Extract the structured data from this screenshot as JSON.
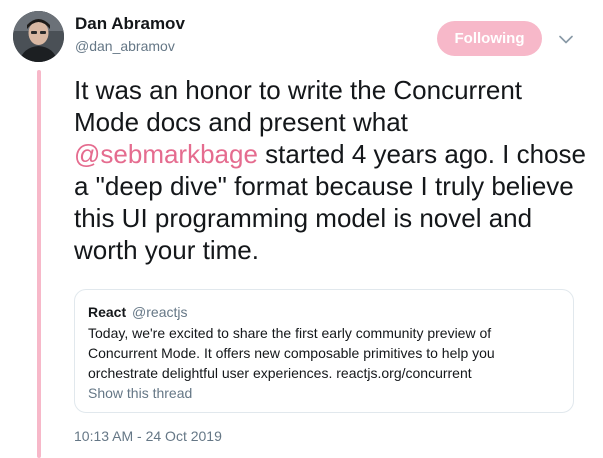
{
  "author": {
    "name": "Dan Abramov",
    "handle": "@dan_abramov"
  },
  "follow_button": {
    "label": "Following"
  },
  "tweet": {
    "text_before_mention": "It was an honor to write the Concurrent Mode docs and present what ",
    "mention": "@sebmarkbage",
    "text_after_mention": " started 4 years ago. I chose a \"deep dive\" format because I truly believe this UI programming model is novel and worth your time."
  },
  "quoted_tweet": {
    "name": "React",
    "handle": "@reactjs",
    "lines": [
      "Today, we're excited to share the first early community preview of",
      "Concurrent Mode. It offers new composable primitives to help you",
      "orchestrate delightful user experiences. reactjs.org/concurrent"
    ],
    "show_thread_label": "Show this thread"
  },
  "timestamp": "10:13 AM - 24 Oct 2019",
  "icons": {
    "avatar": "avatar-photo",
    "caret": "chevron-down-icon"
  },
  "colors": {
    "accent": "#f7b8c9",
    "mention": "#e56c8f",
    "secondary_text": "#657786",
    "primary_text": "#14171a",
    "border": "#e1e8ed"
  }
}
